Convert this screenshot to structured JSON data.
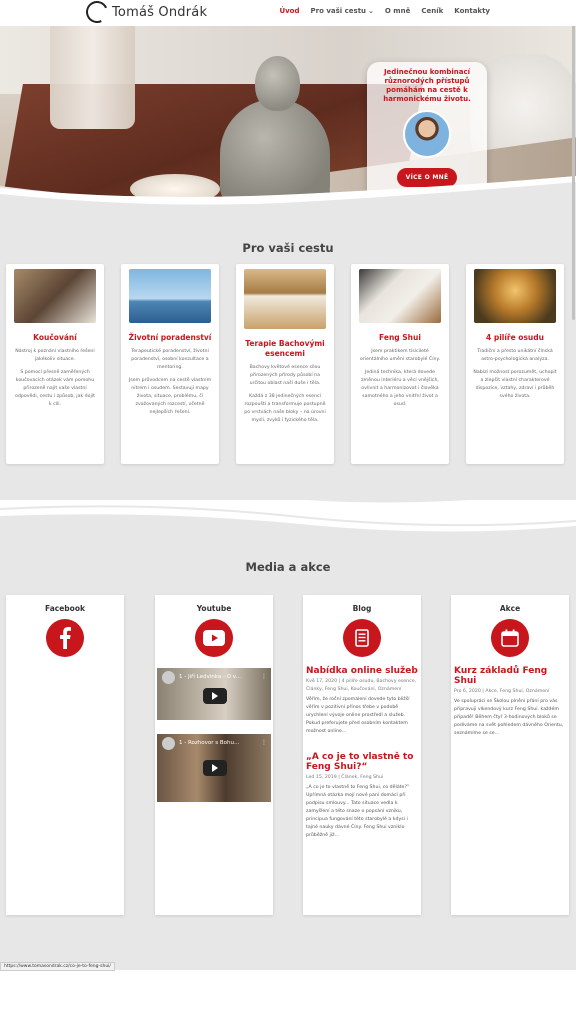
{
  "header": {
    "logo_text": "Tomáš Ondrák",
    "nav": [
      {
        "label": "Úvod",
        "active": true,
        "has_dropdown": false
      },
      {
        "label": "Pro vaši cestu",
        "active": false,
        "has_dropdown": true
      },
      {
        "label": "O mně",
        "active": false,
        "has_dropdown": false
      },
      {
        "label": "Ceník",
        "active": false,
        "has_dropdown": false
      },
      {
        "label": "Kontakty",
        "active": false,
        "has_dropdown": false
      }
    ]
  },
  "hero": {
    "tagline": "Jedinečnou kombinací různorodých přístupů pomáhám na cestě k harmonickému životu.",
    "button_label": "VÍCE O MNĚ"
  },
  "section_journey": {
    "title": "Pro vaši cestu",
    "cards": [
      {
        "title": "Koučování",
        "image_icon": "coaching-desk-photo",
        "paragraphs": [
          "Nástroj k poznání vlastního řešení jakékoliv situace.",
          "S pomocí přesně zaměřených koučovacích otázek vám pomohu přirozeně najít vaše vlastní odpovědi, cestu i způsob, jak dojít k cíli."
        ]
      },
      {
        "title": "Životní poradenství",
        "image_icon": "lighthouse-photo",
        "paragraphs": [
          "Terapeutické poradenství, životní poradenství, osobní konzultace a mentoring.",
          "Jsem průvodcem na cestě vlastním nitrem i osudem. Sestavuji mapy života, situace, problému, či zvažovaných rozcestí, včetně nejlepších řešení."
        ]
      },
      {
        "title": "Terapie Bachovými esencemi",
        "image_icon": "bach-essences-box-photo",
        "paragraphs": [
          "Bachovy květové esence sílou přirozených přírody působí na určitou oblast naší duše i těla.",
          "Každá z 38 jedinečných esencí rozpouští a transformuje postupně po vrstvách naše bloky – na úrovni mysli, zvyků i fyzického těla."
        ]
      },
      {
        "title": "Feng Shui",
        "image_icon": "feng-shui-compass-photo",
        "paragraphs": [
          "Jsem praktikem tisícileté orientálního umění starobylé Číny.",
          "Jediná technika, která dovede změnou interiéru a věcí vnějších, ovlivnit a harmonizovat i člověka samotného a jeho vnitřní život a osud."
        ]
      },
      {
        "title": "4 pilíře osudu",
        "image_icon": "book-landscape-photo",
        "paragraphs": [
          "Tradiční a přesto unikátní čínská astro-psychologická analýza.",
          "Nabízí možnost porozumět, uchopit a zlepšit vlastní charakterové dispozice, vztahy, zdraví i průběh svého života."
        ]
      }
    ]
  },
  "section_media": {
    "title": "Media a akce",
    "columns": [
      {
        "title": "Facebook",
        "icon": "facebook-icon"
      },
      {
        "title": "Youtube",
        "icon": "youtube-icon",
        "videos": [
          {
            "title": "1 - Jiří Ledvinka - O v..."
          },
          {
            "title": "1 - Rozhovor s Bohu..."
          }
        ]
      },
      {
        "title": "Blog",
        "icon": "blog-document-icon",
        "posts": [
          {
            "title": "Nabídka online služeb",
            "meta": "Kvě 17, 2020 | 4 pilíře osudu, Bachovy esence, Články, Feng Shui, Koučování, Oznámení",
            "excerpt": "Věřím, že roční zpomalení dovede tyto bližší věřím v pozitivní přínos třebe v podobě urychlení vývoje online prostředí a služeb. Pokud preferujete před osobním kontaktem možnost online..."
          },
          {
            "title": "„A co je to vlastně to Feng Shui?“",
            "meta": "Led 15, 2019 | Článek, Feng Shui",
            "excerpt": "„A co je to vlastně to Feng Shui, co děláte?“ Upřímná otázka mojí nové paní domácí při podpisu smlouvy... Tato situace vedla k zamyšlení a této snaze o popsání vzniku, principua fungování této starobylé a kdysi i tajné nauky dávné Číny. Feng Shui vzniklo průběžně již..."
          }
        ]
      },
      {
        "title": "Akce",
        "icon": "calendar-icon",
        "posts": [
          {
            "title": "Kurz základů Feng Shui",
            "meta": "Pro 6, 2020 | Akce, Feng Shui, Oznámení",
            "excerpt": "Ve spolupráci se Školou plnění přání pro vás připravuji víkendový kurz Feng Shui. každém případě! Během čtyř 3-hodinových bloků se podíváme na svět pohledem dávného Orientu, seznámíme se se..."
          }
        ]
      }
    ]
  },
  "status_bar": {
    "url": "https://www.tomasondrak.cz/co-je-to-feng-shui/"
  },
  "colors": {
    "accent": "#c8161d",
    "section_bg": "#e7e7e7"
  }
}
